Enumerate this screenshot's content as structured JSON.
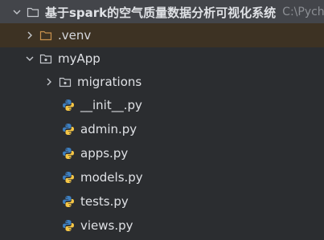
{
  "tree": {
    "root": {
      "label": "基于spark的空气质量数据分析可视化系统",
      "path": "C:\\Pycha",
      "icon": "folder-icon",
      "expanded": true
    },
    "venv": {
      "label": ".venv",
      "icon": "excluded-folder-icon",
      "expanded": false
    },
    "myapp": {
      "label": "myApp",
      "icon": "package-folder-icon",
      "expanded": true
    },
    "migrations": {
      "label": "migrations",
      "icon": "package-folder-icon",
      "expanded": false
    },
    "files": [
      {
        "label": "__init__.py",
        "icon": "python-icon"
      },
      {
        "label": "admin.py",
        "icon": "python-icon"
      },
      {
        "label": "apps.py",
        "icon": "python-icon"
      },
      {
        "label": "models.py",
        "icon": "python-icon"
      },
      {
        "label": "tests.py",
        "icon": "python-icon"
      },
      {
        "label": "views.py",
        "icon": "python-icon"
      }
    ]
  },
  "colors": {
    "background": "#2b2d30",
    "selected_row": "#43454a",
    "venv_row": "#3d3223",
    "venv_folder": "#c9924e",
    "text": "#dfe1e5",
    "muted_text": "#8c8f94",
    "python_blue": "#3d7ebf",
    "python_yellow": "#f5c646"
  }
}
